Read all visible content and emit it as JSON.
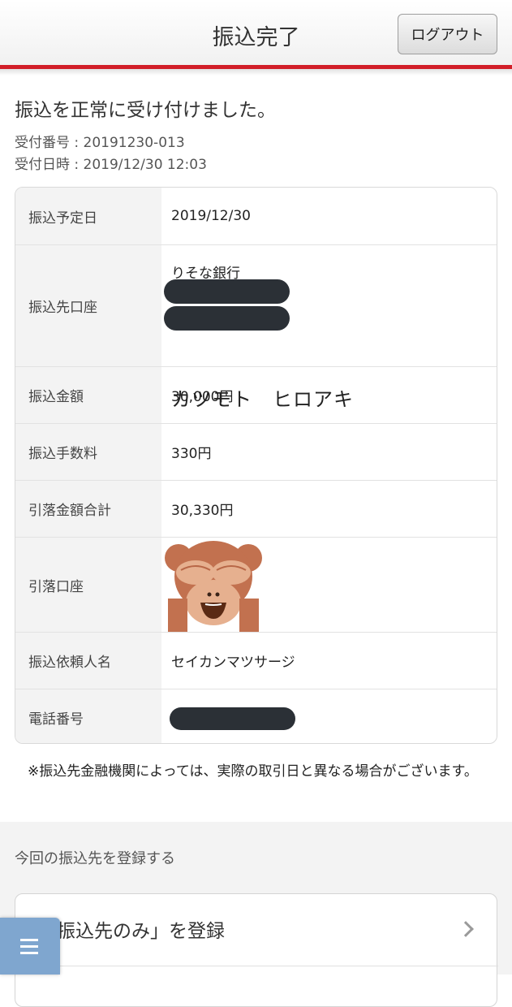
{
  "header": {
    "title": "振込完了",
    "logout_label": "ログアウト"
  },
  "completion": {
    "message": "振込を正常に受け付けました。",
    "receipt_number": "受付番号 : 20191230-013",
    "receipt_datetime": "受付日時 : 2019/12/30 12:03"
  },
  "details": {
    "scheduled_date": {
      "label": "振込予定日",
      "value": "2019/12/30"
    },
    "destination_account": {
      "label": "振込先口座",
      "bank": "りそな銀行",
      "holder": "カツモト　ヒロアキ"
    },
    "amount": {
      "label": "振込金額",
      "value": "30,000円"
    },
    "fee": {
      "label": "振込手数料",
      "value": "330円"
    },
    "total_debit": {
      "label": "引落金額合計",
      "value": "30,330円"
    },
    "debit_account": {
      "label": "引落口座",
      "icon": "see-no-evil-monkey-icon"
    },
    "requester_name": {
      "label": "振込依頼人名",
      "value": "セイカンマツサージ"
    },
    "phone": {
      "label": "電話番号"
    }
  },
  "note": "※振込先金融機関によっては、実際の取引日と異なる場合がございます。",
  "register": {
    "heading": "今回の振込先を登録する",
    "option_label": "「振込先のみ」を登録"
  },
  "colors": {
    "accent_red": "#d21e28",
    "menu_button": "#7fa6cf",
    "redaction": "#2b3036"
  }
}
